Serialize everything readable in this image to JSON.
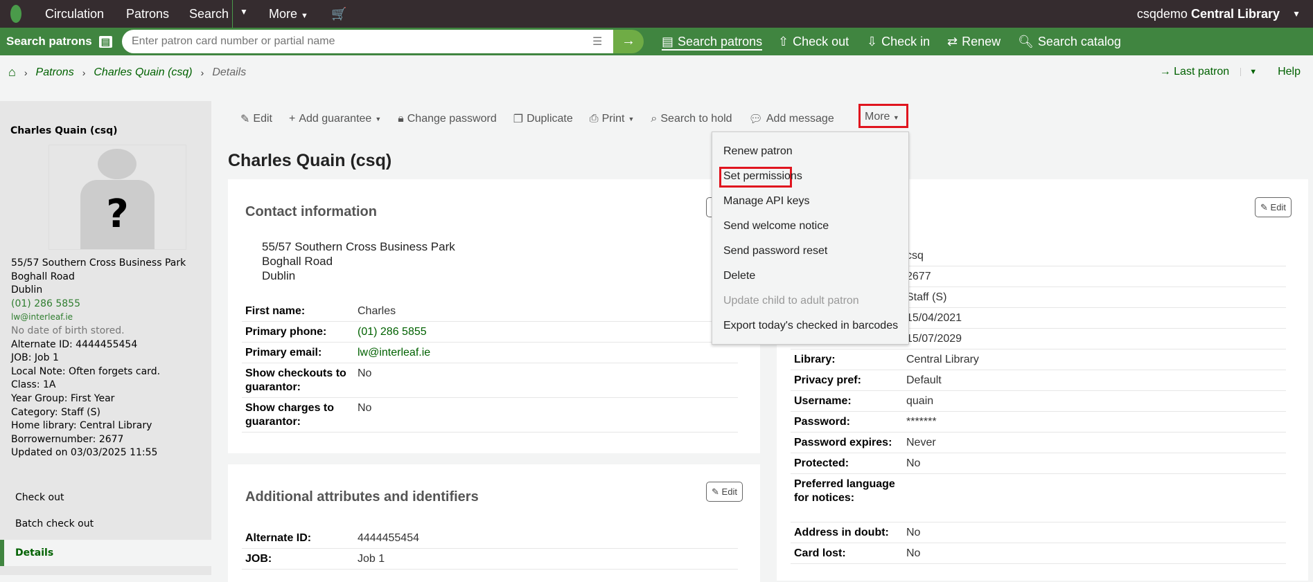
{
  "topnav": {
    "items": [
      "Circulation",
      "Patrons",
      "Search",
      "More"
    ],
    "user": "csqdemo",
    "library": "Central Library"
  },
  "searchbar": {
    "label": "Search patrons",
    "placeholder": "Enter patron card number or partial name",
    "links": [
      "Search patrons",
      "Check out",
      "Check in",
      "Renew",
      "Search catalog"
    ]
  },
  "breadcrumb": [
    "Patrons",
    "Charles Quain (csq)",
    "Details"
  ],
  "right_links": {
    "last_patron": "Last patron",
    "help": "Help"
  },
  "sidebar": {
    "name": "Charles Quain (csq)",
    "info": [
      "55/57 Southern Cross Business Park",
      "Boghall Road",
      "Dublin"
    ],
    "phone": "(01) 286 5855",
    "email": "lw@interleaf.ie",
    "dob": "No date of birth stored.",
    "details": [
      "Alternate ID: 4444455454",
      "JOB: Job 1",
      "Local Note: Often forgets card.",
      "Class: 1A",
      "Year Group: First Year",
      "Category: Staff (S)",
      "Home library: Central Library",
      "Borrowernumber: 2677",
      "Updated on 03/03/2025 11:55"
    ],
    "nav": [
      "Check out",
      "Batch check out",
      "Details"
    ]
  },
  "toolbar": {
    "edit": "Edit",
    "add_guarantee": "Add guarantee",
    "change_password": "Change password",
    "duplicate": "Duplicate",
    "print": "Print",
    "search_to_hold": "Search to hold",
    "add_message": "Add message",
    "more": "More"
  },
  "dropdown": [
    "Renew patron",
    "Set permissions",
    "Manage API keys",
    "Send welcome notice",
    "Send password reset",
    "Delete",
    "Update child to adult patron",
    "Export today's checked in barcodes"
  ],
  "page_title": "Charles Quain (csq)",
  "contact": {
    "title": "Contact information",
    "address": [
      "55/57 Southern Cross Business Park",
      "Boghall Road",
      "Dublin"
    ],
    "rows": [
      [
        "First name:",
        "Charles"
      ],
      [
        "Primary phone:",
        "(01) 286 5855"
      ],
      [
        "Primary email:",
        "lw@interleaf.ie"
      ],
      [
        "Show checkouts to guarantor:",
        "No"
      ],
      [
        "Show charges to guarantor:",
        "No"
      ]
    ]
  },
  "attributes": {
    "title": "Additional attributes and identifiers",
    "edit": "Edit",
    "rows": [
      [
        "Alternate ID:",
        "4444455454"
      ],
      [
        "JOB:",
        "Job 1"
      ]
    ]
  },
  "library_card": {
    "edit": "Edit",
    "rows": [
      [
        "",
        "csq"
      ],
      [
        "",
        "2677"
      ],
      [
        "",
        "Staff (S)"
      ],
      [
        "",
        "15/04/2021"
      ],
      [
        "",
        "15/07/2029"
      ],
      [
        "Library:",
        "Central Library"
      ],
      [
        "Privacy pref:",
        "Default"
      ],
      [
        "Username:",
        "quain"
      ],
      [
        "Password:",
        "*******"
      ],
      [
        "Password expires:",
        "Never"
      ],
      [
        "Protected:",
        "No"
      ],
      [
        "Preferred language for notices:",
        ""
      ],
      [
        "Address in doubt:",
        "No"
      ],
      [
        "Card lost:",
        "No"
      ]
    ]
  },
  "colors": {
    "topnav": "#352c2f",
    "green": "#408540",
    "link": "#006100",
    "highlight": "#e0141e"
  }
}
